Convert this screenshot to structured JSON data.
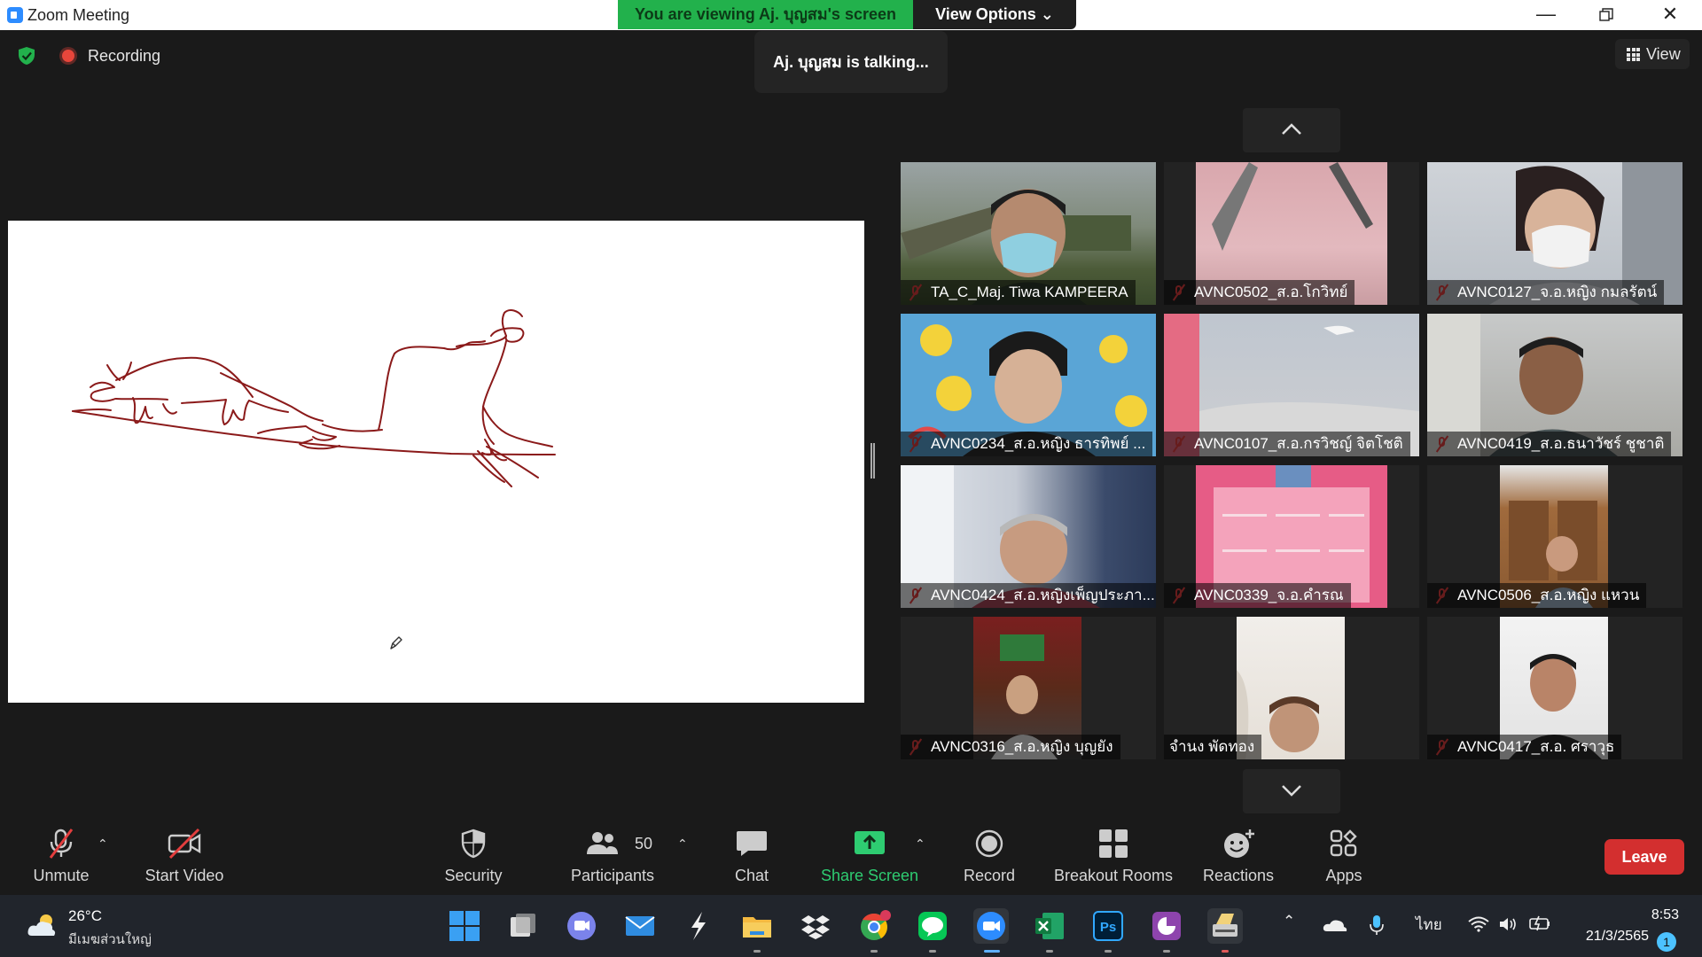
{
  "window": {
    "title": "Zoom Meeting"
  },
  "banner": {
    "viewing": "You are viewing Aj. บุญสม's screen",
    "view_options": "View Options"
  },
  "overlay": {
    "recording": "Recording",
    "talking": "Aj. บุญสม is talking...",
    "view": "View"
  },
  "gallery": {
    "participants": [
      {
        "name": "TA_C_Maj. Tiwa KAMPEERA",
        "muted": true
      },
      {
        "name": "AVNC0502_ส.อ.โกวิทย์",
        "muted": true
      },
      {
        "name": "AVNC0127_จ.อ.หญิง กมลรัตน์",
        "muted": true
      },
      {
        "name": "AVNC0234_ส.อ.หญิง ธารทิพย์ ...",
        "muted": true
      },
      {
        "name": "AVNC0107_ส.อ.กรวิชญ์ จิตโชติ",
        "muted": true
      },
      {
        "name": "AVNC0419_ส.อ.ธนาวัชร์ ชูชาติ",
        "muted": true
      },
      {
        "name": "AVNC0424_ส.อ.หญิงเพ็ญประภา...",
        "muted": true
      },
      {
        "name": "AVNC0339_จ.อ.คำรณ",
        "muted": true
      },
      {
        "name": "AVNC0506_ส.อ.หญิง แหวน",
        "muted": true
      },
      {
        "name": "AVNC0316_ส.อ.หญิง บุญยัง",
        "muted": true
      },
      {
        "name": "จำนง พัดทอง",
        "muted": false
      },
      {
        "name": "AVNC0417_ส.อ. ศราวุธ",
        "muted": true
      }
    ]
  },
  "toolbar": {
    "unmute": "Unmute",
    "start_video": "Start Video",
    "security": "Security",
    "participants_count": "50",
    "participants": "Participants",
    "chat": "Chat",
    "share_screen": "Share Screen",
    "record": "Record",
    "breakout_rooms": "Breakout Rooms",
    "reactions": "Reactions",
    "apps": "Apps",
    "leave": "Leave"
  },
  "taskbar": {
    "temperature": "26°C",
    "weather": "มีเมฆส่วนใหญ่",
    "language": "ไทย",
    "time": "8:53",
    "date": "21/3/2565",
    "notifications": "1",
    "apps": [
      "windows-start",
      "task-view",
      "teams-chat",
      "mail",
      "app-s",
      "file-explorer",
      "dropbox",
      "chrome",
      "line",
      "zoom",
      "excel",
      "photoshop",
      "pdf",
      "scanner"
    ]
  },
  "colors": {
    "banner_green": "#22b14c",
    "leave_red": "#d32f2f",
    "share_green": "#2ecc71",
    "pen_stroke": "#8b1a1a",
    "mute_red": "#e43e3e"
  }
}
